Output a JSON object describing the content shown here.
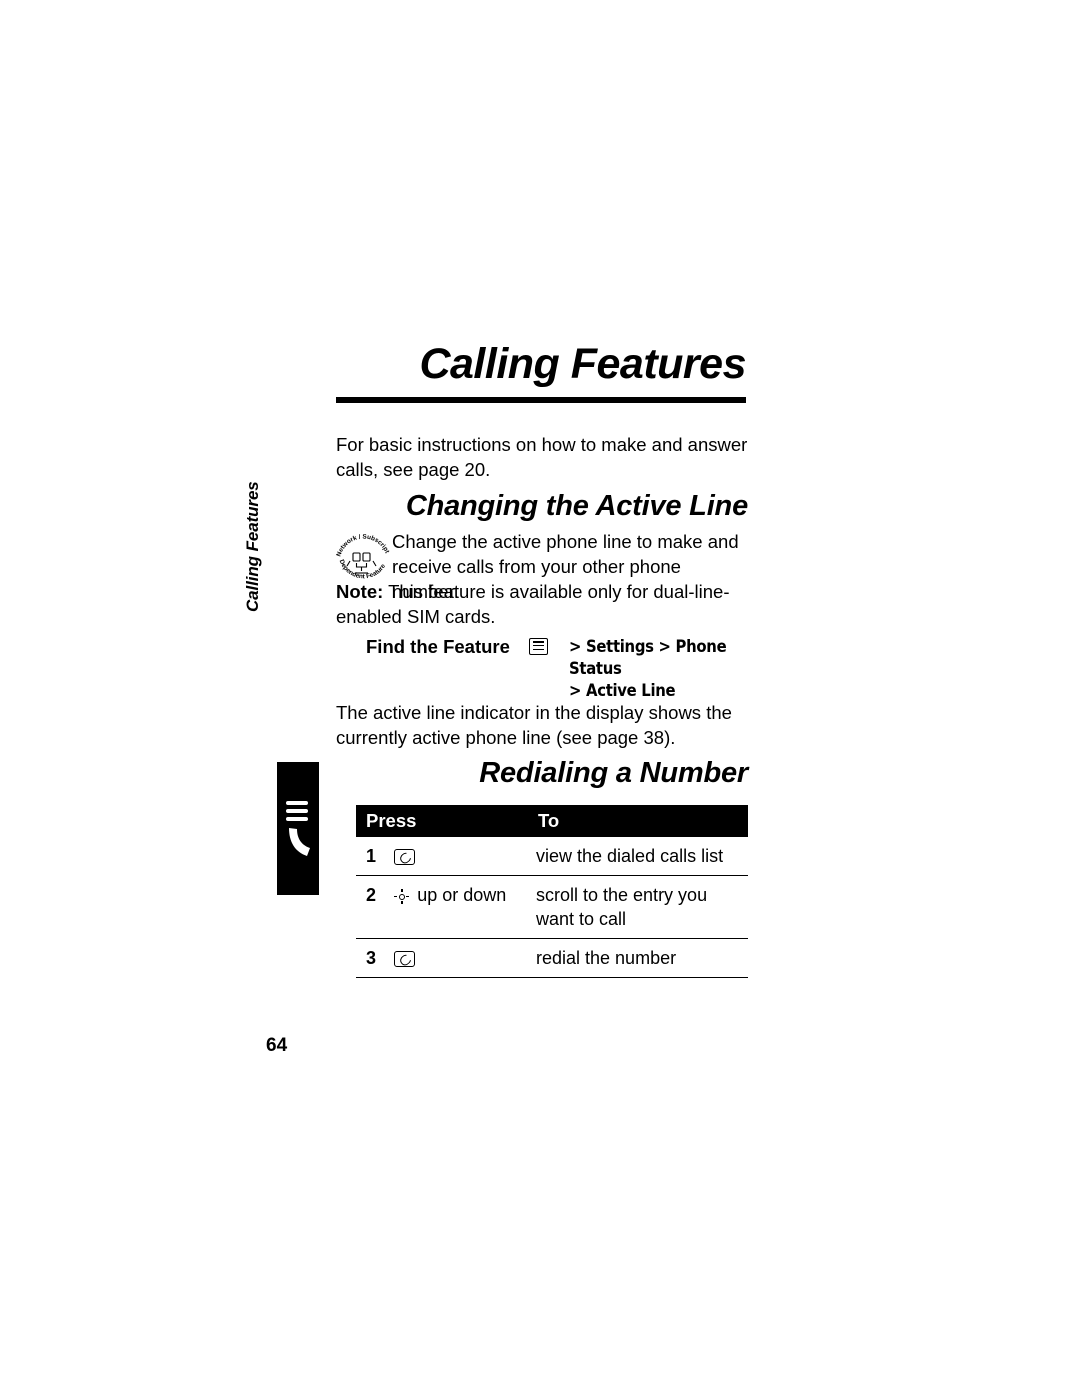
{
  "chapter": {
    "title": "Calling Features",
    "side_tab_label": "Calling Features"
  },
  "intro": {
    "text": "For basic instructions on how to make and answer calls, see page 20."
  },
  "sections": [
    {
      "heading": "Changing the Active Line",
      "body": "Change the active phone line to make and receive calls from your other phone number.",
      "note_label": "Note:",
      "note_text": " This feature is available only for dual-line-enabled SIM cards.",
      "icon_name": "network-subscription-dependent-feature-icon",
      "icon_text_top": "Network / Subscription",
      "icon_text_bottom": "Dependent Feature",
      "find_feature": {
        "label": "Find the Feature",
        "menu_icon": "menu-key-icon",
        "path_line1": "> Settings > Phone Status",
        "path_line2": "> Active Line"
      },
      "after_text": "The active line indicator in the display shows the currently active phone line (see page 38)."
    },
    {
      "heading": "Redialing a Number"
    }
  ],
  "press_to_table": {
    "headers": {
      "press": "Press",
      "to": "To"
    },
    "rows": [
      {
        "num": "1",
        "key_icon": "send-key-icon",
        "key_label": "",
        "to": "view the dialed calls list"
      },
      {
        "num": "2",
        "key_icon": "navigation-key-icon",
        "key_label": "up or down",
        "to": "scroll to the entry you want to call"
      },
      {
        "num": "3",
        "key_icon": "send-key-icon",
        "key_label": "",
        "to": "redial the number"
      }
    ]
  },
  "footer": {
    "page_number": "64"
  }
}
